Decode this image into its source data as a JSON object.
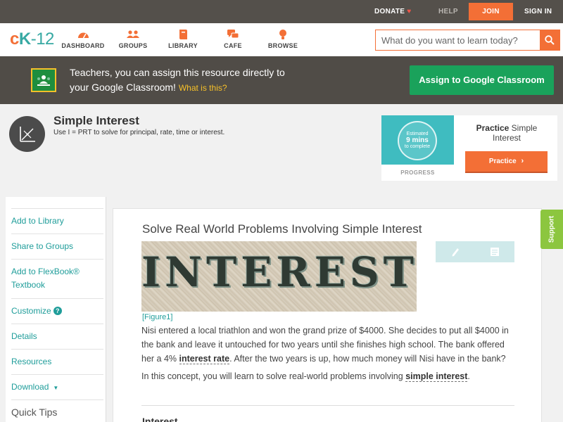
{
  "topbar": {
    "donate": "DONATE",
    "help": "HELP",
    "join": "JOIN",
    "signin": "SIGN IN"
  },
  "logo": {
    "c": "c",
    "k": "K",
    "n": "-12"
  },
  "nav": {
    "items": [
      {
        "label": "DASHBOARD",
        "icon": "dashboard-icon"
      },
      {
        "label": "GROUPS",
        "icon": "groups-icon"
      },
      {
        "label": "LIBRARY",
        "icon": "library-icon"
      },
      {
        "label": "CAFE",
        "icon": "cafe-icon"
      },
      {
        "label": "BROWSE",
        "icon": "browse-icon"
      }
    ]
  },
  "search": {
    "placeholder": "What do you want to learn today?"
  },
  "banner": {
    "message_line1": "Teachers, you can assign this resource directly to",
    "message_line2": "your Google Classroom!",
    "what_link": "What is this?",
    "assign_button": "Assign to Google Classroom"
  },
  "concept": {
    "title": "Simple Interest",
    "subtitle": "Use I = PRT to solve for principal, rate, time or interest."
  },
  "practice": {
    "estimated": "Estimated",
    "mins": "9 mins",
    "to_complete": "to complete",
    "progress_label": "PROGRESS",
    "title_bold": "Practice",
    "title_rest": "Simple Interest",
    "button": "Practice"
  },
  "sidebar": {
    "items": [
      {
        "label": "Add to Library"
      },
      {
        "label": "Share to Groups"
      },
      {
        "label": "Add to FlexBook® Textbook"
      },
      {
        "label": "Customize"
      },
      {
        "label": "Details"
      },
      {
        "label": "Resources"
      },
      {
        "label": "Download"
      },
      {
        "label": "Quick Tips"
      }
    ]
  },
  "lesson": {
    "title": "Solve Real World Problems Involving Simple Interest",
    "hero_word": "INTEREST",
    "figure_caption": "[Figure1]",
    "para1_a": "Nisi entered a local triathlon and won the grand prize of $4000. She decides to put all $4000 in the bank and leave it untouched for two years until she finishes high school. The bank offered her a 4%",
    "para1_term": "interest rate",
    "para1_b": ". After the two years is up, how much money will Nisi have in the bank?",
    "para2_a": "In this concept, you will learn to solve real-world problems involving",
    "para2_term": "simple interest",
    "para2_b": ".",
    "section": "Interest"
  },
  "support": {
    "label": "Support"
  },
  "colors": {
    "accent": "#f36f36",
    "teal": "#1f9d9a",
    "google_green": "#1aa25b",
    "support_green": "#8cc63f"
  }
}
